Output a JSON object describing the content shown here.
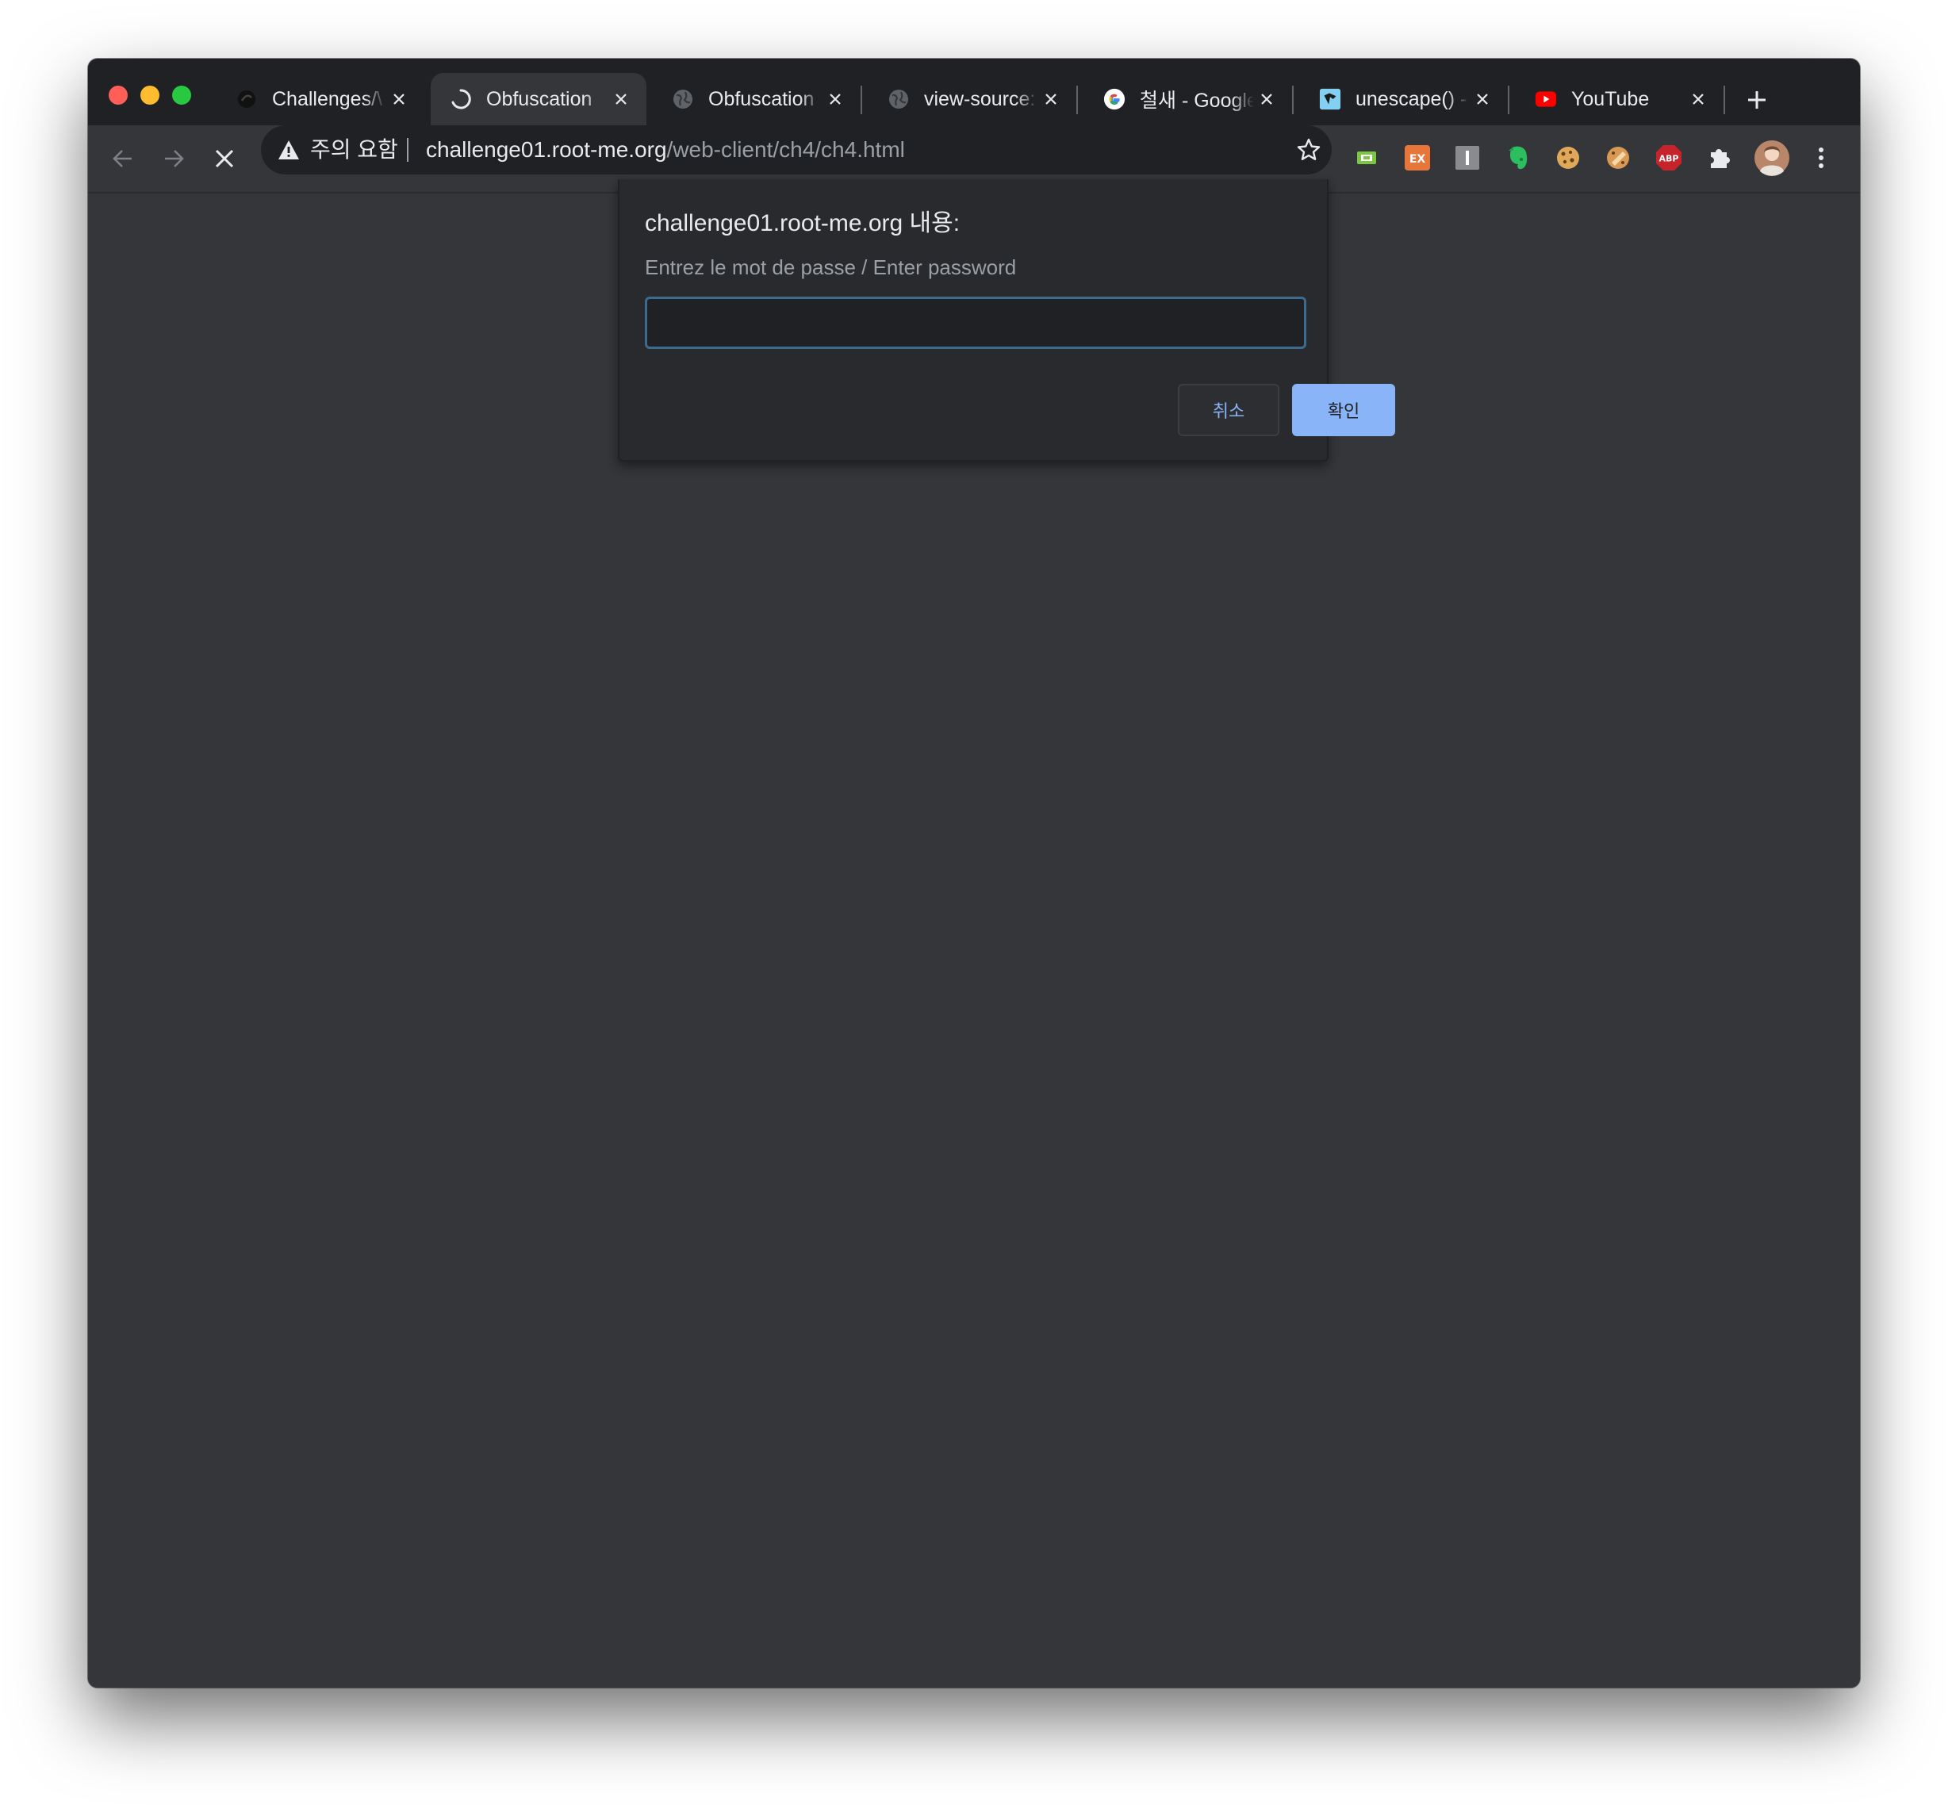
{
  "tabs": [
    {
      "title": "Challenges/\\",
      "favicon": "root-me-icon",
      "active": false
    },
    {
      "title": "Obfuscation",
      "favicon": "loading-spinner-icon",
      "active": true
    },
    {
      "title": "Obfuscation",
      "favicon": "globe-icon",
      "active": false
    },
    {
      "title": "view-source:",
      "favicon": "globe-icon",
      "active": false
    },
    {
      "title": "철새 - Google",
      "favicon": "google-icon",
      "active": false
    },
    {
      "title": "unescape() -",
      "favicon": "mdn-icon",
      "active": false
    },
    {
      "title": "YouTube",
      "favicon": "youtube-icon",
      "active": false
    }
  ],
  "omnibox": {
    "security_label": "주의 요함",
    "url_host": "challenge01.root-me.org",
    "url_path": "/web-client/ch4/ch4.html"
  },
  "extensions": [
    "screenshot-extension-icon",
    "ex-extension-icon",
    "i-extension-icon",
    "evernote-icon",
    "cookie-icon",
    "cookie-editor-icon",
    "adblock-plus-icon",
    "puzzle-extensions-icon",
    "profile-avatar",
    "more-menu-icon"
  ],
  "dialog": {
    "title": "challenge01.root-me.org 내용:",
    "message": "Entrez le mot de passe / Enter password",
    "input_value": "",
    "cancel_label": "취소",
    "ok_label": "확인"
  },
  "colors": {
    "frame": "#202124",
    "toolbar": "#35363a",
    "accent": "#8ab4f8"
  }
}
